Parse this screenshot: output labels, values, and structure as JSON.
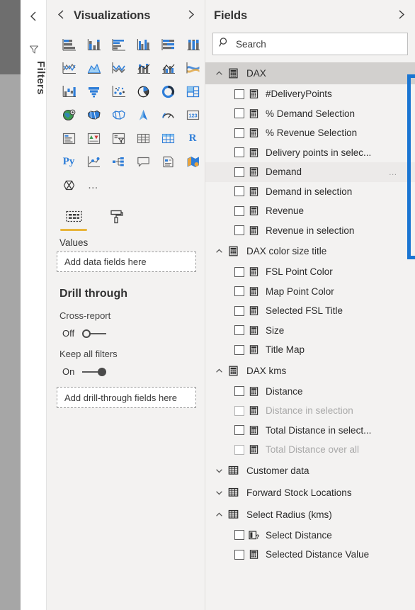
{
  "filters_pane": {
    "collapse_icon": "chevron-left-icon",
    "funnel_icon": "filter-funnel-icon",
    "label": "Filters"
  },
  "visualizations": {
    "title": "Visualizations",
    "collapse_icon": "chevron-left-icon",
    "expand_icon": "chevron-right-icon",
    "icons": [
      "stacked-bar-chart-icon",
      "stacked-column-chart-icon",
      "clustered-bar-chart-icon",
      "clustered-column-chart-icon",
      "100-percent-stacked-bar-chart-icon",
      "100-percent-stacked-column-chart-icon",
      "line-chart-icon",
      "area-chart-icon",
      "stacked-area-chart-icon",
      "line-and-stacked-column-chart-icon",
      "line-and-clustered-column-chart-icon",
      "ribbon-chart-icon",
      "waterfall-chart-icon",
      "funnel-chart-icon",
      "scatter-chart-icon",
      "pie-chart-icon",
      "donut-chart-icon",
      "treemap-icon",
      "map-icon",
      "filled-map-icon",
      "shape-map-icon",
      "arcgis-map-icon",
      "gauge-icon",
      "card-icon",
      "multi-row-card-icon",
      "kpi-icon",
      "slicer-icon",
      "table-icon",
      "matrix-icon",
      "r-script-visual-icon",
      "python-visual-icon",
      "key-influencers-icon",
      "decomposition-tree-icon",
      "qna-icon",
      "smart-narrative-icon",
      "paginated-report-icon",
      "get-more-visuals-icon",
      "more-options-icon"
    ],
    "well_tabs": [
      {
        "icon": "fields-well-icon",
        "active": true
      },
      {
        "icon": "format-paint-roller-icon",
        "active": false
      }
    ],
    "values_label": "Values",
    "values_dropzone": "Add data fields here",
    "drill_through": {
      "title": "Drill through",
      "cross_report_label": "Cross-report",
      "cross_report_state": "Off",
      "keep_all_filters_label": "Keep all filters",
      "keep_all_filters_state": "On",
      "dropzone": "Add drill-through fields here"
    }
  },
  "fields": {
    "title": "Fields",
    "expand_icon": "chevron-right-icon",
    "search": {
      "icon": "search-icon",
      "placeholder": "Search",
      "value": ""
    },
    "annotation": {
      "color": "#1a75d2",
      "shape": "rectangle-highlight"
    },
    "cursor": {
      "icon": "hand-pointer-cursor",
      "over_item": "Demand"
    },
    "groups": [
      {
        "name": "DAX",
        "expanded": true,
        "chevron": "chevron-up-icon",
        "icon": "measure-table-icon",
        "highlighted": true,
        "items": [
          {
            "label": "#DeliveryPoints",
            "icon": "measure-icon",
            "checked": false,
            "disabled": false
          },
          {
            "label": "% Demand Selection",
            "icon": "measure-icon",
            "checked": false,
            "disabled": false
          },
          {
            "label": "% Revenue Selection",
            "icon": "measure-icon",
            "checked": false,
            "disabled": false
          },
          {
            "label": "Delivery points in selec...",
            "icon": "measure-icon",
            "checked": false,
            "disabled": false
          },
          {
            "label": "Demand",
            "icon": "measure-icon",
            "checked": false,
            "disabled": false,
            "hovered": true
          },
          {
            "label": "Demand in selection",
            "icon": "measure-icon",
            "checked": false,
            "disabled": false
          },
          {
            "label": "Revenue",
            "icon": "measure-icon",
            "checked": false,
            "disabled": false
          },
          {
            "label": "Revenue in selection",
            "icon": "measure-icon",
            "checked": false,
            "disabled": false
          }
        ]
      },
      {
        "name": "DAX color size title",
        "expanded": true,
        "chevron": "chevron-up-icon",
        "icon": "measure-table-icon",
        "highlighted": false,
        "items": [
          {
            "label": "FSL Point Color",
            "icon": "measure-icon",
            "checked": false,
            "disabled": false
          },
          {
            "label": "Map Point Color",
            "icon": "measure-icon",
            "checked": false,
            "disabled": false
          },
          {
            "label": "Selected FSL Title",
            "icon": "measure-icon",
            "checked": false,
            "disabled": false
          },
          {
            "label": "Size",
            "icon": "measure-icon",
            "checked": false,
            "disabled": false
          },
          {
            "label": "Title Map",
            "icon": "measure-icon",
            "checked": false,
            "disabled": false
          }
        ]
      },
      {
        "name": "DAX kms",
        "expanded": true,
        "chevron": "chevron-up-icon",
        "icon": "measure-table-icon",
        "highlighted": false,
        "items": [
          {
            "label": "Distance",
            "icon": "measure-icon",
            "checked": false,
            "disabled": false
          },
          {
            "label": "Distance in selection",
            "icon": "measure-icon",
            "checked": false,
            "disabled": true
          },
          {
            "label": "Total Distance in select...",
            "icon": "measure-icon",
            "checked": false,
            "disabled": false
          },
          {
            "label": "Total Distance over all",
            "icon": "measure-icon",
            "checked": false,
            "disabled": true
          }
        ]
      },
      {
        "name": "Customer data",
        "expanded": false,
        "chevron": "chevron-down-icon",
        "icon": "table-grid-icon",
        "highlighted": false,
        "items": []
      },
      {
        "name": "Forward Stock Locations",
        "expanded": false,
        "chevron": "chevron-down-icon",
        "icon": "table-grid-icon",
        "highlighted": false,
        "items": []
      },
      {
        "name": "Select Radius (kms)",
        "expanded": true,
        "chevron": "chevron-up-icon",
        "icon": "table-grid-icon",
        "highlighted": false,
        "items": [
          {
            "label": "Select Distance",
            "icon": "parameter-field-icon",
            "checked": false,
            "disabled": false
          },
          {
            "label": "Selected Distance Value",
            "icon": "measure-icon",
            "checked": false,
            "disabled": false
          }
        ]
      }
    ]
  }
}
